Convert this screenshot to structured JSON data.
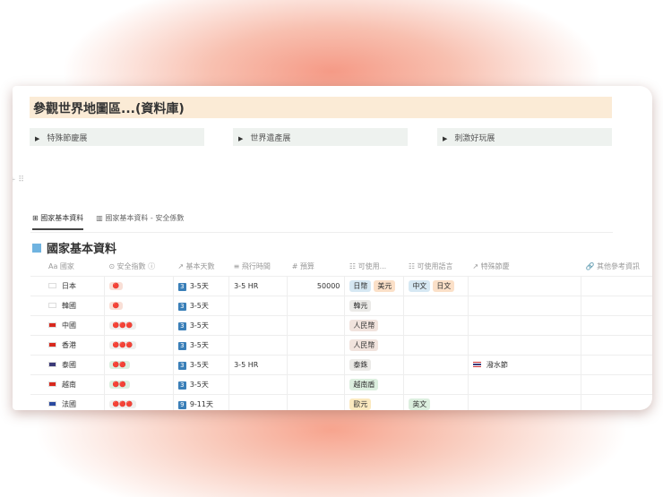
{
  "page_title": "參觀世界地圖區...(資料庫)",
  "toggles": [
    "特殊節慶展",
    "世界遺產展",
    "刺激好玩展"
  ],
  "tabs": [
    "國家基本資料",
    "國家基本資料 - 安全係數"
  ],
  "db_title": "國家基本資料",
  "columns": [
    "Aa 國家",
    "⊙ 安全指數 ⓘ",
    "↗ 基本天數",
    "≡ 飛行時間",
    "# 預算",
    "☷ 可使用...",
    "☷ 可使用語言",
    "↗ 特殊節慶",
    "🔗 其他參考資訊"
  ],
  "rows": [
    {
      "country": "日本",
      "flag": "#ffffff",
      "safety": "🔴",
      "safety_bg": "#f9dfd6",
      "days_num": "3",
      "days": "3-5天",
      "flight": "3-5 HR",
      "budget": "50000",
      "currency": [
        {
          "t": "日幣",
          "c": "#d6e8f3"
        },
        {
          "t": "美元",
          "c": "#fbe0c8"
        }
      ],
      "language": [
        {
          "t": "中文",
          "c": "#d6e8f3"
        },
        {
          "t": "日文",
          "c": "#fbe0c8"
        }
      ],
      "festival": ""
    },
    {
      "country": "韓國",
      "flag": "#ffffff",
      "safety": "🔴",
      "safety_bg": "#f9dfd6",
      "days_num": "3",
      "days": "3-5天",
      "flight": "",
      "budget": "",
      "currency": [
        {
          "t": "韓元",
          "c": "#ebeae7"
        }
      ],
      "language": [],
      "festival": ""
    },
    {
      "country": "中國",
      "flag": "#d8291e",
      "safety": "🔴🔴🔴",
      "safety_bg": "#efefed",
      "days_num": "3",
      "days": "3-5天",
      "flight": "",
      "budget": "",
      "currency": [
        {
          "t": "人民幣",
          "c": "#f1e3dd"
        }
      ],
      "language": [],
      "festival": ""
    },
    {
      "country": "香港",
      "flag": "#d8291e",
      "safety": "🔴🔴🔴",
      "safety_bg": "#efefed",
      "days_num": "3",
      "days": "3-5天",
      "flight": "",
      "budget": "",
      "currency": [
        {
          "t": "人民幣",
          "c": "#f1e3dd"
        }
      ],
      "language": [],
      "festival": ""
    },
    {
      "country": "泰國",
      "flag": "#3b3a78",
      "safety": "🔴🔴",
      "safety_bg": "#dcefdf",
      "days_num": "3",
      "days": "3-5天",
      "flight": "3-5 HR",
      "budget": "",
      "currency": [
        {
          "t": "泰銖",
          "c": "#ebeae7"
        }
      ],
      "language": [],
      "festival": "潑水節"
    },
    {
      "country": "越南",
      "flag": "#d8291e",
      "safety": "🔴🔴",
      "safety_bg": "#dcefdf",
      "days_num": "3",
      "days": "3-5天",
      "flight": "",
      "budget": "",
      "currency": [
        {
          "t": "越南盾",
          "c": "#dcefdf"
        }
      ],
      "language": [],
      "festival": ""
    },
    {
      "country": "法國",
      "flag": "#2a4aa0",
      "safety": "🔴🔴🔴",
      "safety_bg": "#efefed",
      "days_num": "9",
      "days": "9-11天",
      "flight": "",
      "budget": "",
      "currency": [
        {
          "t": "歐元",
          "c": "#fbe9bf"
        }
      ],
      "language": [
        {
          "t": "英文",
          "c": "#dcefdf"
        }
      ],
      "festival": ""
    }
  ]
}
